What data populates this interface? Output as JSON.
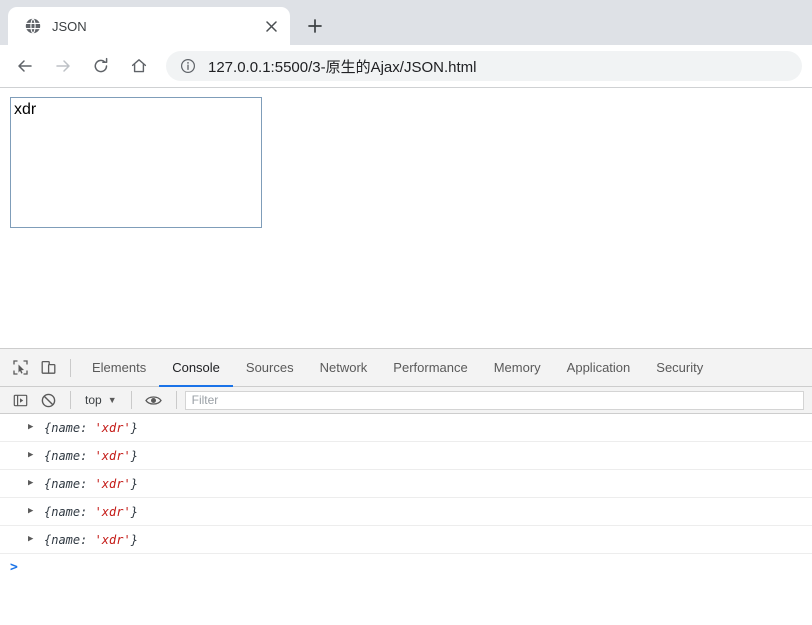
{
  "browser": {
    "tab": {
      "title": "JSON",
      "favicon_icon": "globe-icon",
      "close_icon": "close-icon"
    },
    "newtab_icon": "plus-icon",
    "nav": {
      "back_icon": "arrow-left-icon",
      "forward_icon": "arrow-right-icon",
      "reload_icon": "reload-icon",
      "home_icon": "home-icon"
    },
    "omnibox": {
      "info_icon": "info-circle-icon",
      "url": "127.0.0.1:5500/3-原生的Ajax/JSON.html"
    }
  },
  "page": {
    "textbox_value": "xdr"
  },
  "devtools": {
    "inspect_icon": "inspect-element-icon",
    "device_icon": "device-toolbar-icon",
    "tabs": [
      {
        "label": "Elements",
        "active": false
      },
      {
        "label": "Console",
        "active": true
      },
      {
        "label": "Sources",
        "active": false
      },
      {
        "label": "Network",
        "active": false
      },
      {
        "label": "Performance",
        "active": false
      },
      {
        "label": "Memory",
        "active": false
      },
      {
        "label": "Application",
        "active": false
      },
      {
        "label": "Security",
        "active": false
      }
    ],
    "toolbar": {
      "sidebar_icon": "console-sidebar-icon",
      "clear_icon": "clear-console-icon",
      "context": "top",
      "context_caret": "▼",
      "eye_icon": "live-expression-eye-icon",
      "filter_placeholder": "Filter"
    },
    "console": {
      "arrow_glyph": "▶",
      "entries": [
        {
          "prefix": "{name: ",
          "value": "'xdr'",
          "suffix": "}"
        },
        {
          "prefix": "{name: ",
          "value": "'xdr'",
          "suffix": "}"
        },
        {
          "prefix": "{name: ",
          "value": "'xdr'",
          "suffix": "}"
        },
        {
          "prefix": "{name: ",
          "value": "'xdr'",
          "suffix": "}"
        },
        {
          "prefix": "{name: ",
          "value": "'xdr'",
          "suffix": "}"
        }
      ],
      "prompt": ">"
    }
  },
  "colors": {
    "accent": "#1a73e8",
    "string": "#c41a16",
    "tabstrip": "#dee1e6",
    "textbox_border": "#7f9db9"
  }
}
